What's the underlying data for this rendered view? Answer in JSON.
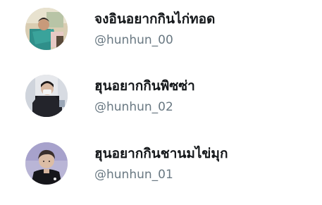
{
  "accounts": [
    {
      "display_name": "จงอินอยากกินไก่ทอด",
      "handle": "@hunhun_00",
      "avatar_icon": "user-avatar-photo"
    },
    {
      "display_name": "ฮุนอยากกินพิซซ่า",
      "handle": "@hunhun_02",
      "avatar_icon": "user-avatar-photo"
    },
    {
      "display_name": "ฮุนอยากกินชานมไข่มุก",
      "handle": "@hunhun_01",
      "avatar_icon": "user-avatar-photo"
    }
  ],
  "colors": {
    "name_text": "#14171a",
    "handle_text": "#697882",
    "background": "#ffffff"
  }
}
